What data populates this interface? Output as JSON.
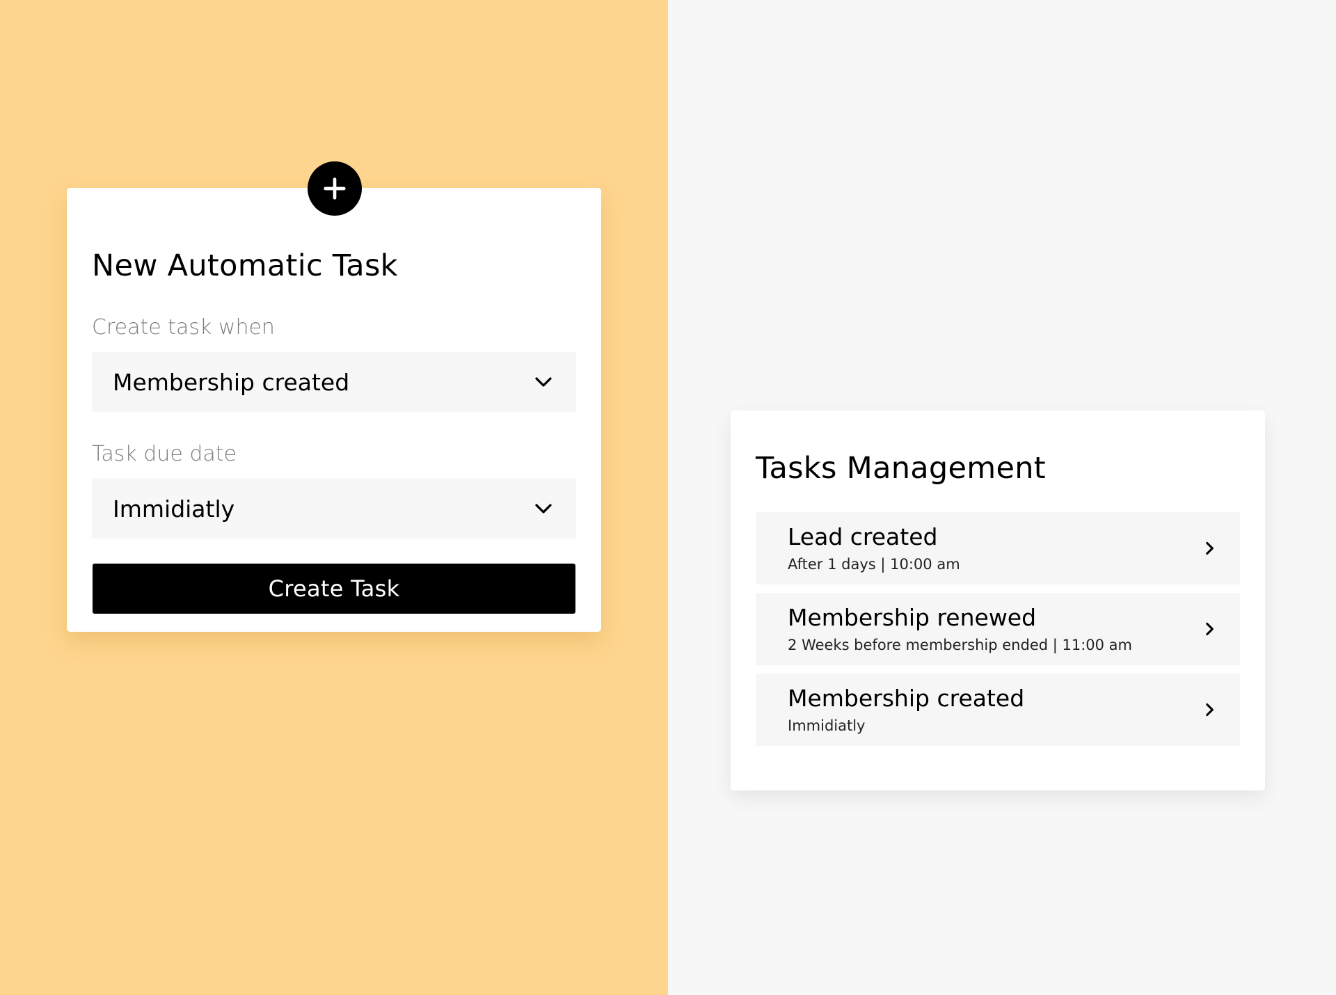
{
  "colors": {
    "left_background": "#fed58e",
    "right_background": "#f7f7f7",
    "card_background": "#ffffff",
    "button_background": "#000000",
    "button_text": "#ffffff",
    "label_text": "#7d7d7d",
    "field_background": "#f7f7f7"
  },
  "new_task": {
    "add_icon": "plus-icon",
    "title": "New Automatic Task",
    "trigger_label": "Create task when",
    "trigger_value": "Membership created",
    "due_label": "Task due date",
    "due_value": "Immidiatly",
    "dropdown_icon": "chevron-down-icon",
    "submit_label": "Create Task"
  },
  "tasks_management": {
    "title": "Tasks Management",
    "item_icon": "chevron-right-icon",
    "items": [
      {
        "title": "Lead created",
        "subtitle": "After 1 days | 10:00 am"
      },
      {
        "title": "Membership renewed",
        "subtitle": "2 Weeks before membership ended | 11:00 am"
      },
      {
        "title": "Membership created",
        "subtitle": "Immidiatly"
      }
    ]
  }
}
